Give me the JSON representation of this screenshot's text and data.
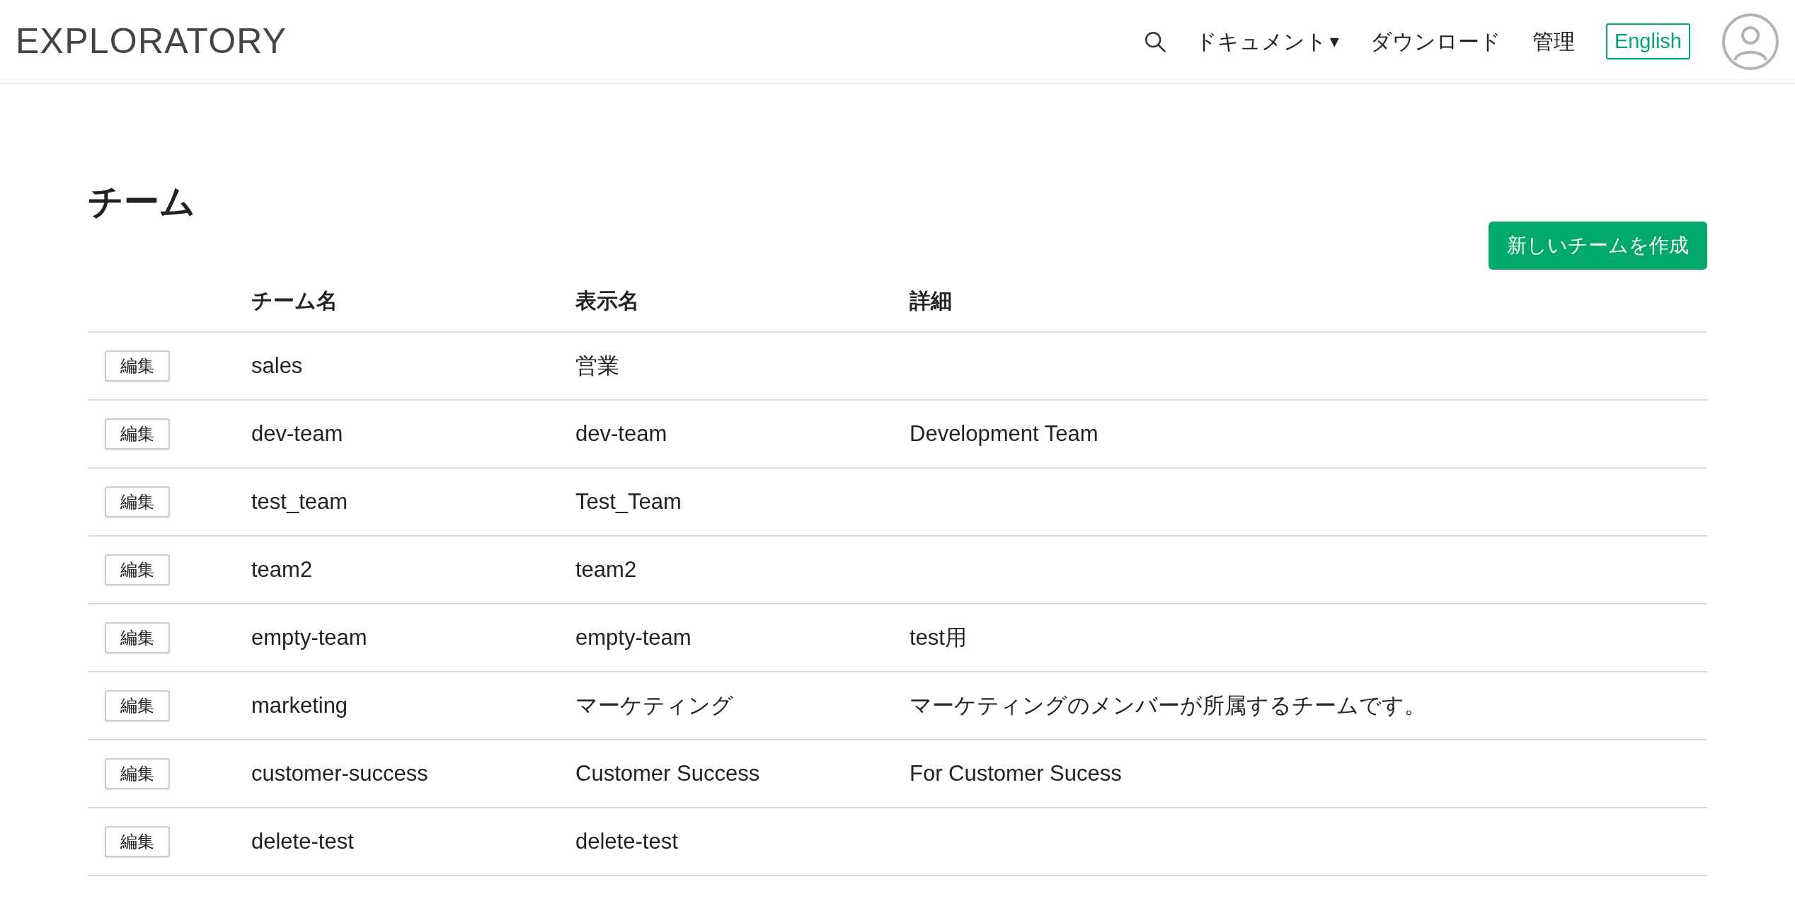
{
  "header": {
    "logo": "EXPLORATORY",
    "nav": [
      {
        "kind": "dropdown",
        "label": "ドキュメント",
        "caret": "▾"
      },
      {
        "kind": "link",
        "label": "ダウンロード"
      },
      {
        "kind": "link",
        "label": "管理"
      },
      {
        "kind": "language",
        "label": "English"
      }
    ]
  },
  "page": {
    "title": "チーム",
    "create_button": "新しいチームを作成"
  },
  "table": {
    "columns": [
      "チーム名",
      "表示名",
      "詳細"
    ],
    "rows": [
      {
        "edit": "編集",
        "name": "sales",
        "display_name": "営業",
        "details": ""
      },
      {
        "edit": "編集",
        "name": "dev-team",
        "display_name": "dev-team",
        "details": "Development Team"
      },
      {
        "edit": "編集",
        "name": "test_team",
        "display_name": "Test_Team",
        "details": ""
      },
      {
        "edit": "編集",
        "name": "team2",
        "display_name": "team2",
        "details": ""
      },
      {
        "edit": "編集",
        "name": "empty-team",
        "display_name": "empty-team",
        "details": "test用"
      },
      {
        "edit": "編集",
        "name": "marketing",
        "display_name": "マーケティング",
        "details": "マーケティングのメンバーが所属するチームです。"
      },
      {
        "edit": "編集",
        "name": "customer-success",
        "display_name": "Customer Success",
        "details": "For Customer Sucess"
      },
      {
        "edit": "編集",
        "name": "delete-test",
        "display_name": "delete-test",
        "details": ""
      }
    ]
  }
}
